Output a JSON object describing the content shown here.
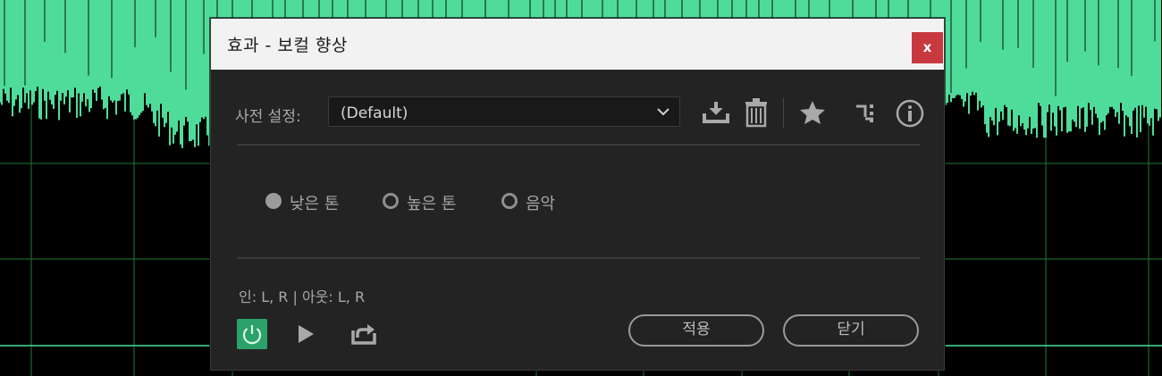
{
  "dialog": {
    "title": "효과 - 보컬 향상",
    "close_label": "x"
  },
  "preset": {
    "label": "사전 설정:",
    "selected": "(Default)"
  },
  "toolbar": {
    "icons": [
      "download-icon",
      "trash-icon",
      "star-icon",
      "routing-icon",
      "info-icon"
    ]
  },
  "mode": {
    "options": [
      {
        "label": "낮은 톤",
        "selected": true
      },
      {
        "label": "높은 톤",
        "selected": false
      },
      {
        "label": "음악",
        "selected": false
      }
    ]
  },
  "channels": {
    "text": "인: L, R | 아웃: L, R"
  },
  "footer": {
    "apply_label": "적용",
    "close_label": "닫기"
  },
  "colors": {
    "waveform": "#4fdc9a",
    "grid": "#1f7a34",
    "power_on": "#2aa26a",
    "close_red": "#c7393f"
  }
}
